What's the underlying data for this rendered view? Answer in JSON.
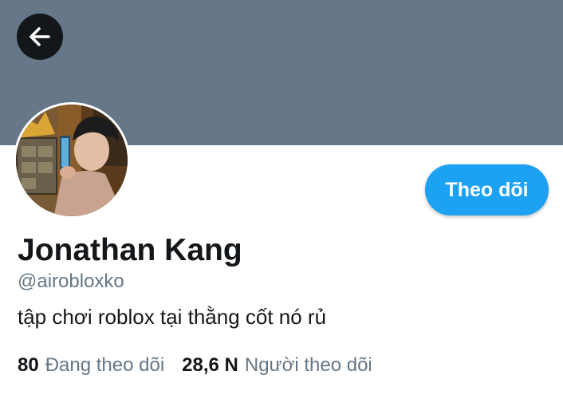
{
  "header": {
    "back_icon": "arrow-left-icon",
    "banner_color": "#66778a"
  },
  "profile": {
    "avatar_icon": "profile-photo",
    "display_name": "Jonathan Kang",
    "handle": "@airobloxko",
    "bio": "tập chơi roblox tại thằng cốt nó rủ",
    "follow_label": "Theo dõi",
    "accent_color": "#1da1f2"
  },
  "stats": {
    "following_count": "80",
    "following_label": "Đang theo dõi",
    "followers_count": "28,6 N",
    "followers_label": "Người theo dõi"
  }
}
